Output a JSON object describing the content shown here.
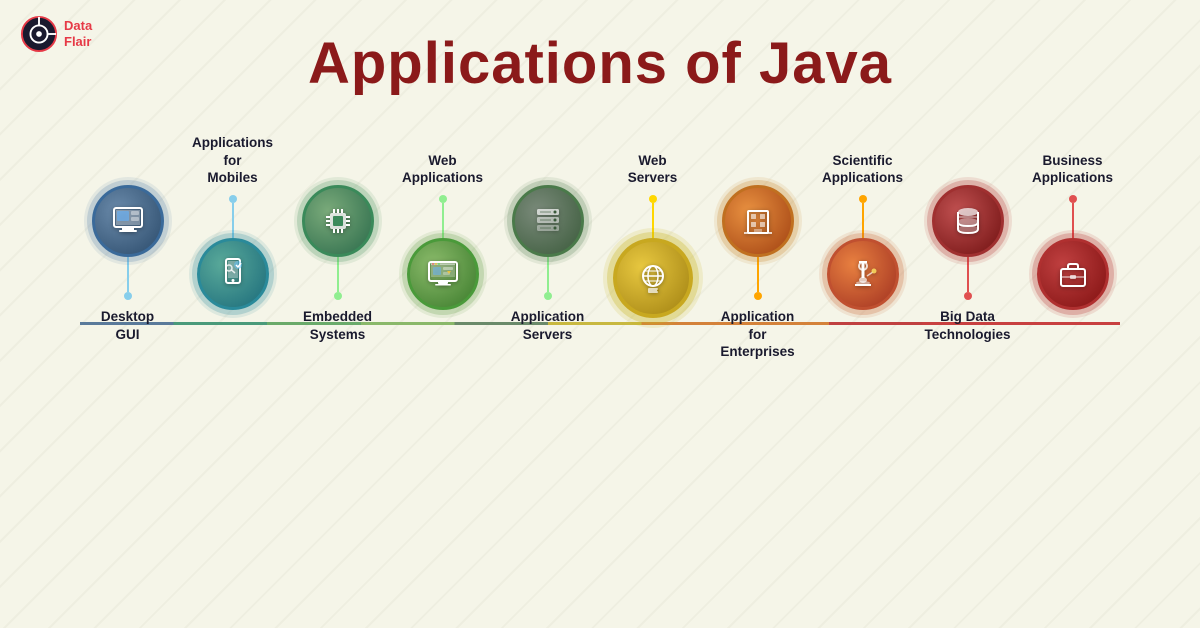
{
  "logo": {
    "name_line1": "Data",
    "name_line2": "Flair"
  },
  "title": "Applications of Java",
  "nodes": [
    {
      "id": 1,
      "label_top": "",
      "label_bottom": "Desktop\nGUI",
      "icon": "desktop",
      "position": "bottom",
      "color_outer": "#3a6a9a",
      "color_inner": "#2a4a6a"
    },
    {
      "id": 2,
      "label_top": "Applications for\nMobiles",
      "label_bottom": "",
      "icon": "mobile",
      "position": "top",
      "color_outer": "#2a8a9a",
      "color_inner": "#1a6a7a"
    },
    {
      "id": 3,
      "label_top": "",
      "label_bottom": "Embedded\nSystems",
      "icon": "chip",
      "position": "bottom",
      "color_outer": "#3a8a5a",
      "color_inner": "#2a6a4a"
    },
    {
      "id": 4,
      "label_top": "Web\nApplications",
      "label_bottom": "",
      "icon": "monitor",
      "position": "top",
      "color_outer": "#4a9a3a",
      "color_inner": "#3a7a2a"
    },
    {
      "id": 5,
      "label_top": "",
      "label_bottom": "Application\nServers",
      "icon": "server",
      "position": "bottom",
      "color_outer": "#4a7a4a",
      "color_inner": "#3a5a3a"
    },
    {
      "id": 6,
      "label_top": "Web\nServers",
      "label_bottom": "",
      "icon": "globe",
      "position": "top",
      "color_outer": "#c8a820",
      "color_inner": "#a08010"
    },
    {
      "id": 7,
      "label_top": "",
      "label_bottom": "Application for\nEnterprises",
      "icon": "building",
      "position": "bottom",
      "color_outer": "#c07020",
      "color_inner": "#a04010"
    },
    {
      "id": 8,
      "label_top": "Scientific\nApplications",
      "label_bottom": "",
      "icon": "microscope",
      "position": "top",
      "color_outer": "#c05030",
      "color_inner": "#a03020"
    },
    {
      "id": 9,
      "label_top": "",
      "label_bottom": "Big Data\nTechnologies",
      "icon": "database",
      "position": "bottom",
      "color_outer": "#a03030",
      "color_inner": "#701010"
    },
    {
      "id": 10,
      "label_top": "Business\nApplications",
      "label_bottom": "",
      "icon": "briefcase",
      "position": "top",
      "color_outer": "#b03030",
      "color_inner": "#801010"
    }
  ]
}
